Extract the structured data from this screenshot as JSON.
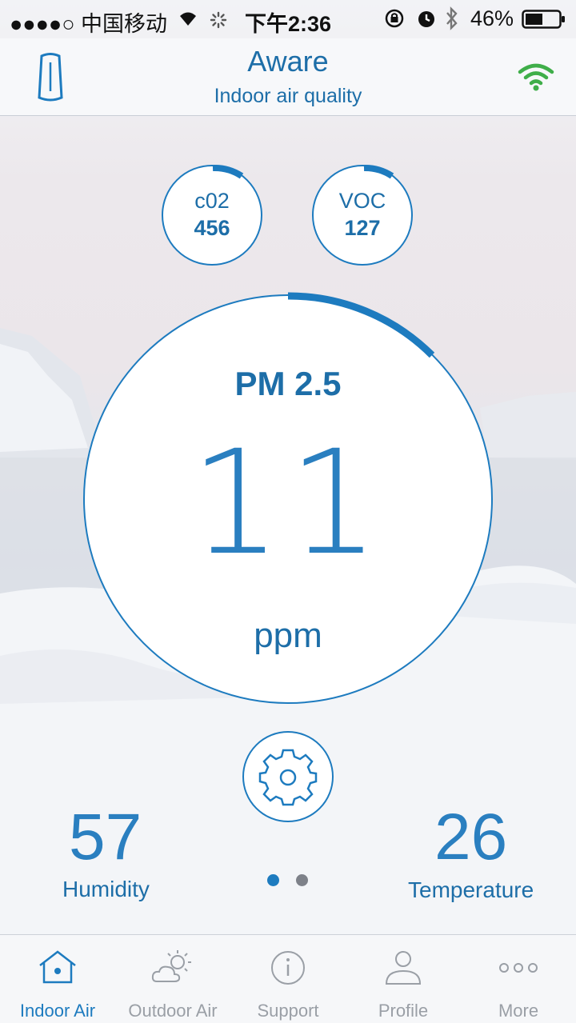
{
  "status_bar": {
    "carrier": "●●●●○ 中国移动",
    "time": "下午2:36",
    "battery": "46%"
  },
  "header": {
    "title": "Aware",
    "subtitle": "Indoor air quality"
  },
  "sensors": {
    "co2": {
      "label": "c02",
      "value": "456"
    },
    "voc": {
      "label": "VOC",
      "value": "127"
    },
    "pm25": {
      "label": "PM 2.5",
      "value": "11",
      "unit": "ppm"
    }
  },
  "metrics": {
    "humidity": {
      "value": "57",
      "label": "Humidity"
    },
    "temperature": {
      "value": "26",
      "label": "Temperature"
    }
  },
  "pager": {
    "pages": 2,
    "current": 1
  },
  "tabs": [
    {
      "label": "Indoor Air",
      "icon": "home-icon",
      "active": true
    },
    {
      "label": "Outdoor Air",
      "icon": "partly-sunny-icon",
      "active": false
    },
    {
      "label": "Support",
      "icon": "info-icon",
      "active": false
    },
    {
      "label": "Profile",
      "icon": "person-icon",
      "active": false
    },
    {
      "label": "More",
      "icon": "more-dots-icon",
      "active": false
    }
  ],
  "colors": {
    "accent": "#1d7bbf",
    "text": "#1d6ea8",
    "inactive": "#9a9fa6",
    "wifi": "#3fae49"
  }
}
